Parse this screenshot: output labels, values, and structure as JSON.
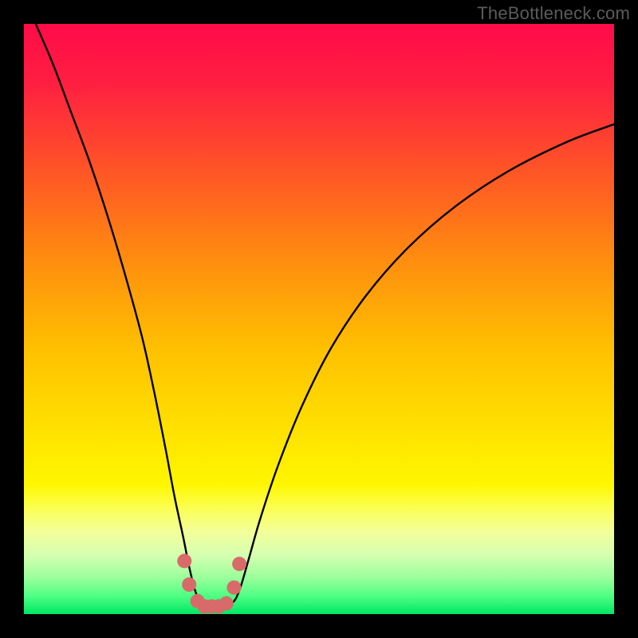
{
  "watermark": {
    "text": "TheBottleneck.com"
  },
  "chart_data": {
    "type": "line",
    "title": "",
    "xlabel": "",
    "ylabel": "",
    "xlim": [
      0,
      100
    ],
    "ylim": [
      0,
      100
    ],
    "grid": false,
    "legend": false,
    "background_gradient": {
      "stops": [
        {
          "offset": 0.0,
          "color": "#ff0b49"
        },
        {
          "offset": 0.1,
          "color": "#ff1f41"
        },
        {
          "offset": 0.25,
          "color": "#ff5526"
        },
        {
          "offset": 0.4,
          "color": "#ff8d0f"
        },
        {
          "offset": 0.55,
          "color": "#ffc000"
        },
        {
          "offset": 0.7,
          "color": "#ffe400"
        },
        {
          "offset": 0.78,
          "color": "#fff600"
        },
        {
          "offset": 0.82,
          "color": "#fbff52"
        },
        {
          "offset": 0.86,
          "color": "#f3ff9a"
        },
        {
          "offset": 0.9,
          "color": "#d6ffb0"
        },
        {
          "offset": 0.94,
          "color": "#97ff9a"
        },
        {
          "offset": 0.97,
          "color": "#4cff82"
        },
        {
          "offset": 1.0,
          "color": "#00e765"
        }
      ]
    },
    "series": [
      {
        "name": "bottleneck-curve",
        "stroke": "#000000",
        "stroke_width": 2.4,
        "x": [
          2,
          5,
          8,
          11,
          14,
          17,
          20,
          22,
          24,
          25.5,
          27,
          28,
          29,
          30,
          31,
          32.8,
          35.2,
          36.5,
          38,
          40,
          43,
          47,
          52,
          58,
          65,
          73,
          82,
          92,
          100
        ],
        "y": [
          100,
          93,
          85,
          77,
          68,
          58,
          47,
          38,
          28,
          20,
          13,
          8,
          4,
          1.8,
          1.2,
          1.2,
          1.8,
          4,
          9,
          16,
          25,
          35,
          45,
          54,
          62,
          69,
          75,
          80,
          83
        ]
      }
    ],
    "markers": {
      "color": "#d96a6a",
      "radius": 9,
      "points": [
        {
          "x": 27.2,
          "y": 9
        },
        {
          "x": 28.0,
          "y": 5
        },
        {
          "x": 29.4,
          "y": 2.2
        },
        {
          "x": 30.6,
          "y": 1.3
        },
        {
          "x": 31.8,
          "y": 1.3
        },
        {
          "x": 33.0,
          "y": 1.3
        },
        {
          "x": 34.3,
          "y": 1.8
        },
        {
          "x": 35.6,
          "y": 4.5
        },
        {
          "x": 36.5,
          "y": 8.5
        }
      ]
    }
  }
}
